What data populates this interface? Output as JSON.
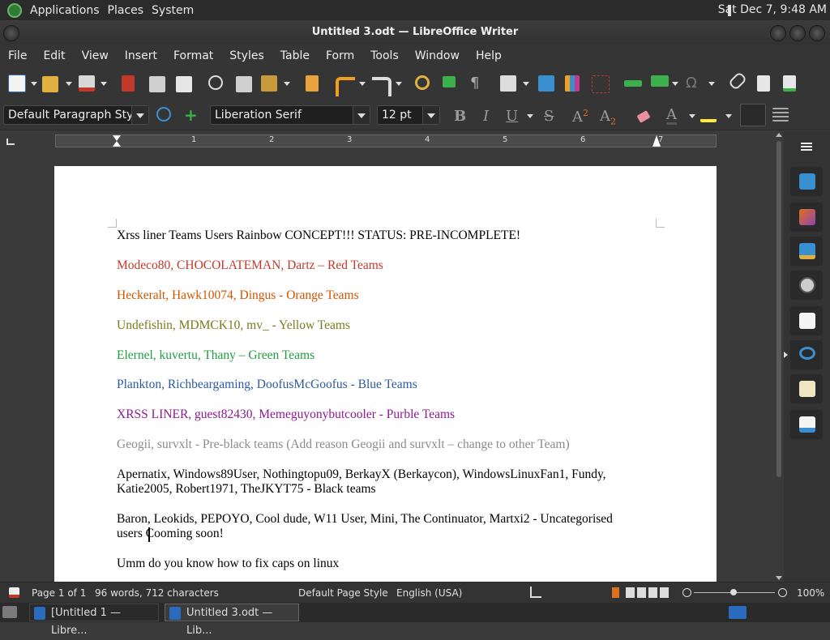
{
  "system_panel": {
    "applications": "Applications",
    "places": "Places",
    "system": "System",
    "clock": "Sat Dec 7,  9:48 AM"
  },
  "window": {
    "title": "Untitled 3.odt — LibreOffice Writer"
  },
  "menu": [
    "File",
    "Edit",
    "View",
    "Insert",
    "Format",
    "Styles",
    "Table",
    "Form",
    "Tools",
    "Window",
    "Help"
  ],
  "formatting": {
    "paragraph_style": "Default Paragraph Style",
    "font_name": "Liberation Serif",
    "font_size": "12 pt"
  },
  "ruler": {
    "numbers": [
      "1",
      "2",
      "3",
      "4",
      "5",
      "6",
      "7"
    ]
  },
  "document": {
    "paragraphs": [
      {
        "text": "Xrss liner Teams Users Rainbow CONCEPT!!!  STATUS: PRE-INCOMPLETE!",
        "color": "#000000"
      },
      {
        "text": "Modeco80, CHOCOLATEMAN, Dartz – Red Teams",
        "color": "#c0392b"
      },
      {
        "text": "Heckeralt, Hawk10074, Dingus - Orange Teams",
        "color": "#d35400"
      },
      {
        "text": "Undefishin, MDMCK10, mv_ - Yellow Teams",
        "color": "#7a7a1e"
      },
      {
        "text": "Elernel, kuvertu, Thany – Green Teams",
        "color": "#1e9e3e"
      },
      {
        "text": "Plankton, Richbeargaming, DoofusMcGoofus - Blue Teams",
        "color": "#2c5aa0"
      },
      {
        "text": "XRSS LINER, guest82430, Memeguyonybutcooler - Purble Teams",
        "color": "#8e1a8e"
      },
      {
        "text": "Geogii, survxlt - Pre-black teams (Add reason Geogii and survxlt – change to other Team)",
        "color": "#8a8a8a"
      },
      {
        "text": "Apernatix, Windows89User, Nothingtopu09, BerkayX (Berkaycon), WindowsLinuxFan1, Fundy, Katie2005, Robert1971, TheJKYT75 - Black teams",
        "color": "#000000"
      },
      {
        "text": "Baron, Leokids, PEPOYO, Cool dude, W11 User, Mini, The Continuator, Martxi2 - Uncategorised users   Cooming soon!",
        "color": "#000000"
      },
      {
        "text": "Umm do you know how to fix caps on linux",
        "color": "#000000"
      }
    ]
  },
  "status_bar": {
    "page": "Page 1 of 1",
    "words": "96 words, 712 characters",
    "page_style": "Default Page Style",
    "language": "English (USA)",
    "zoom": "100%"
  },
  "taskbar": {
    "items": [
      "[Untitled 1 — Libre...",
      "Untitled 3.odt — Lib..."
    ]
  }
}
